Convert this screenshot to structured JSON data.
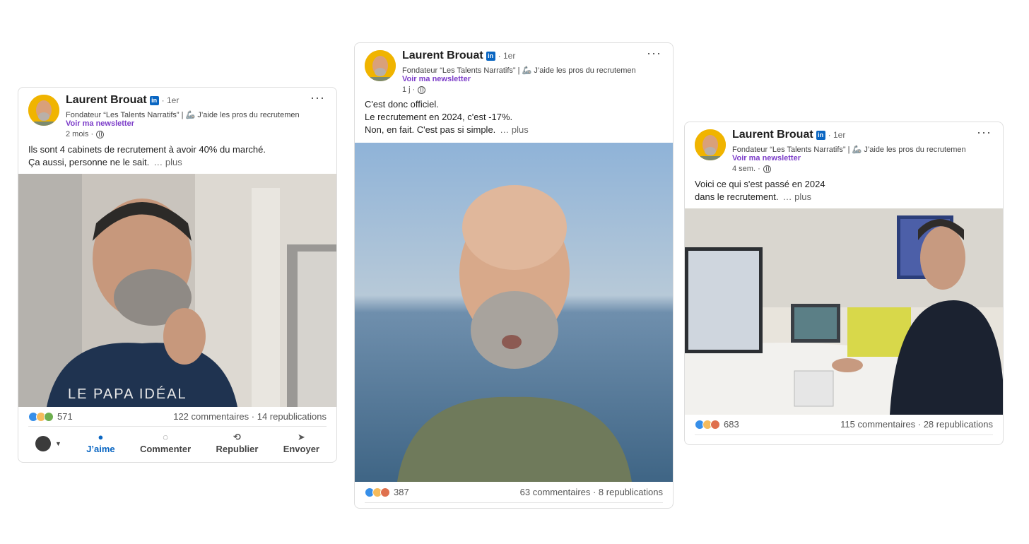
{
  "author": {
    "name": "Laurent Brouat",
    "badge": "in",
    "degree": "· 1er",
    "headline": "Fondateur “Les Talents Narratifs” | 🦾 J’aide les pros du recrutement",
    "newsletter": "Voir ma newsletter"
  },
  "posts": [
    {
      "time": "2 mois ·",
      "text_lines": [
        "Ils sont 4 cabinets de recrutement à avoir 40% du marché.",
        "Ça aussi, personne ne le sait."
      ],
      "more": "… plus",
      "reactions_count": "571",
      "comments_reposts": "122 commentaires · 14 republications",
      "photo_caption": "LE PAPA IDÉAL"
    },
    {
      "time": "1 j ·",
      "text_lines": [
        "C'est donc officiel.",
        "Le recrutement en 2024, c'est -17%.",
        "Non, en fait. C'est pas si simple."
      ],
      "more": "… plus",
      "reactions_count": "387",
      "comments_reposts": "63 commentaires · 8 republications"
    },
    {
      "time": "4 sem. ·",
      "text_lines": [
        "Voici ce qui s'est passé en 2024",
        "dans le recrutement."
      ],
      "more": "… plus",
      "reactions_count": "683",
      "comments_reposts": "115 commentaires · 28 republications"
    }
  ],
  "actions": {
    "like": "J’aime",
    "comment": "Commenter",
    "repost": "Republier",
    "send": "Envoyer"
  },
  "colors": {
    "linkedin_blue": "#0a66c2",
    "newsletter_purple": "#7d3ec9",
    "avatar_bg": "#f0b400"
  }
}
